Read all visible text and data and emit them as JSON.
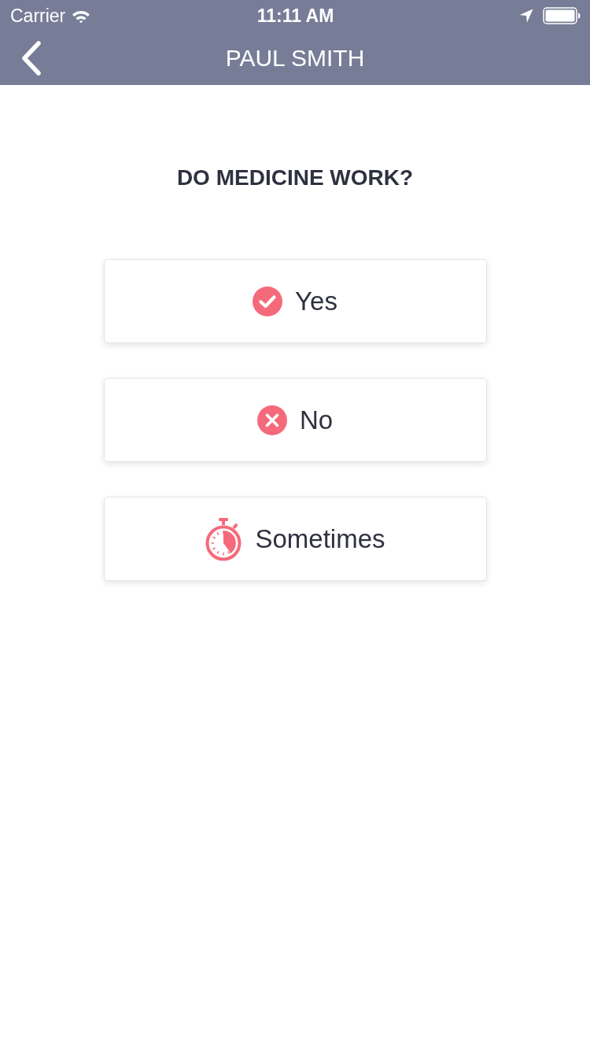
{
  "status_bar": {
    "carrier": "Carrier",
    "time": "11:11 AM"
  },
  "nav_bar": {
    "title": "PAUL SMITH"
  },
  "question": "DO MEDICINE WORK?",
  "options": [
    {
      "kind": "yes",
      "label": "Yes"
    },
    {
      "kind": "no",
      "label": "No"
    },
    {
      "kind": "sometimes",
      "label": "Sometimes"
    }
  ]
}
